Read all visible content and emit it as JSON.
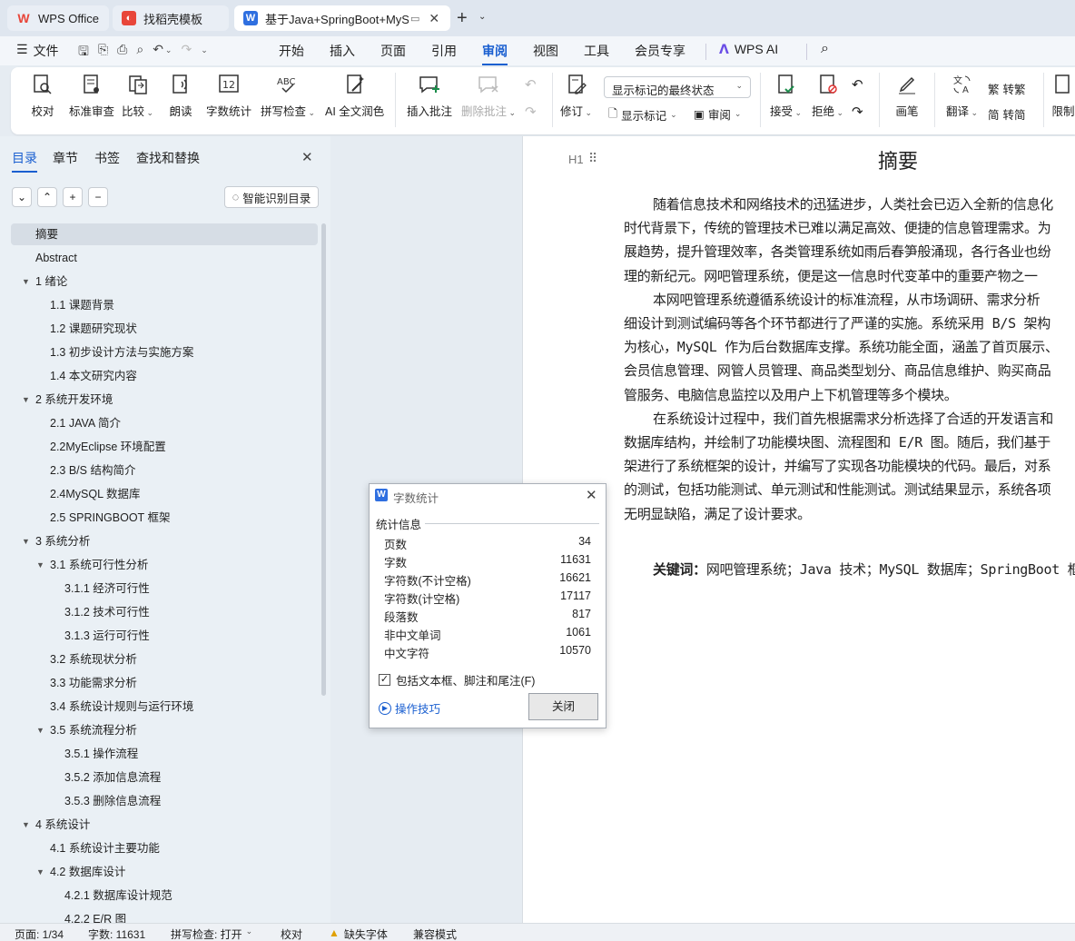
{
  "tabs": [
    {
      "label": "WPS Office",
      "icon": "wps-logo-icon"
    },
    {
      "label": "找稻壳模板",
      "icon": "docer-icon"
    },
    {
      "label": "基于Java+SpringBoot+MyS",
      "icon": "writer-doc-icon"
    }
  ],
  "menu": {
    "file": "文件",
    "items": [
      "开始",
      "插入",
      "页面",
      "引用",
      "审阅",
      "视图",
      "工具",
      "会员专享"
    ],
    "active": "审阅",
    "ai": "WPS AI"
  },
  "ribbon": {
    "proofread": "校对",
    "std_review": "标准审查",
    "compare": "比较",
    "read_aloud": "朗读",
    "word_count": "字数统计",
    "spell_check": "拼写检查",
    "ai_polish": "AI 全文润色",
    "insert_comment": "插入批注",
    "delete_comment": "删除批注",
    "markup_select": "显示标记的最终状态",
    "track": "修订",
    "show_markup": "显示标记",
    "review": "审阅",
    "accept": "接受",
    "reject": "拒绝",
    "ink": "画笔",
    "translate": "翻译",
    "to_traditional": "转繁",
    "to_simplified": "转简",
    "restrict": "限制"
  },
  "nav": {
    "tabs": [
      "目录",
      "章节",
      "书签",
      "查找和替换"
    ],
    "smart_toc": "智能识别目录",
    "items": [
      {
        "label": "摘要",
        "level": 1,
        "expand": false,
        "selected": true
      },
      {
        "label": "Abstract",
        "level": 1,
        "expand": false
      },
      {
        "label": "1  绪论",
        "level": 1,
        "expand": true
      },
      {
        "label": "1.1  课题背景",
        "level": 2,
        "expand": false
      },
      {
        "label": "1.2  课题研究现状",
        "level": 2,
        "expand": false
      },
      {
        "label": "1.3  初步设计方法与实施方案",
        "level": 2,
        "expand": false
      },
      {
        "label": "1.4  本文研究内容",
        "level": 2,
        "expand": false
      },
      {
        "label": "2  系统开发环境",
        "level": 1,
        "expand": true
      },
      {
        "label": "2.1 JAVA 简介",
        "level": 2,
        "expand": false
      },
      {
        "label": "2.2MyEclipse 环境配置",
        "level": 2,
        "expand": false
      },
      {
        "label": "2.3 B/S 结构简介",
        "level": 2,
        "expand": false
      },
      {
        "label": "2.4MySQL 数据库",
        "level": 2,
        "expand": false
      },
      {
        "label": "2.5 SPRINGBOOT 框架",
        "level": 2,
        "expand": false
      },
      {
        "label": "3  系统分析",
        "level": 1,
        "expand": true
      },
      {
        "label": "3.1  系统可行性分析",
        "level": 2,
        "expand": true
      },
      {
        "label": "3.1.1  经济可行性",
        "level": 3,
        "expand": false
      },
      {
        "label": "3.1.2  技术可行性",
        "level": 3,
        "expand": false
      },
      {
        "label": "3.1.3  运行可行性",
        "level": 3,
        "expand": false
      },
      {
        "label": "3.2  系统现状分析",
        "level": 2,
        "expand": false
      },
      {
        "label": "3.3  功能需求分析",
        "level": 2,
        "expand": false
      },
      {
        "label": "3.4  系统设计规则与运行环境",
        "level": 2,
        "expand": false
      },
      {
        "label": "3.5 系统流程分析",
        "level": 2,
        "expand": true
      },
      {
        "label": "3.5.1 操作流程",
        "level": 3,
        "expand": false
      },
      {
        "label": "3.5.2 添加信息流程",
        "level": 3,
        "expand": false
      },
      {
        "label": "3.5.3 删除信息流程",
        "level": 3,
        "expand": false
      },
      {
        "label": "4  系统设计",
        "level": 1,
        "expand": true
      },
      {
        "label": "4.1  系统设计主要功能",
        "level": 2,
        "expand": false
      },
      {
        "label": "4.2  数据库设计",
        "level": 2,
        "expand": true
      },
      {
        "label": "4.2.1  数据库设计规范",
        "level": 3,
        "expand": false
      },
      {
        "label": "4.2.2 E/R 图",
        "level": 3,
        "expand": false
      }
    ]
  },
  "doc": {
    "heading_marker": "H1",
    "title": "摘要",
    "lines": [
      "随着信息技术和网络技术的迅猛进步，人类社会已迈入全新的信息化",
      "时代背景下，传统的管理技术已难以满足高效、便捷的信息管理需求。为",
      "展趋势，提升管理效率，各类管理系统如雨后春笋般涌现，各行各业也纷",
      "理的新纪元。网吧管理系统，便是这一信息时代变革中的重要产物之一",
      "本网吧管理系统遵循系统设计的标准流程，从市场调研、需求分析",
      "细设计到测试编码等各个环节都进行了严谨的实施。系统采用 B/S 架构",
      "为核心，MySQL 作为后台数据库支撑。系统功能全面，涵盖了首页展示、",
      "会员信息管理、网管人员管理、商品类型划分、商品信息维护、购买商品",
      "管服务、电脑信息监控以及用户上下机管理等多个模块。",
      "在系统设计过程中，我们首先根据需求分析选择了合适的开发语言和",
      "数据库结构，并绘制了功能模块图、流程图和 E/R 图。随后，我们基于",
      "架进行了系统框架的设计，并编写了实现各功能模块的代码。最后，对系",
      "的测试，包括功能测试、单元测试和性能测试。测试结果显示，系统各项",
      "无明显缺陷，满足了设计要求。"
    ],
    "keywords_label": "关键词：",
    "keywords": "网吧管理系统；Java 技术；MySQL 数据库；SpringBoot 框"
  },
  "dialog": {
    "title": "字数统计",
    "section": "统计信息",
    "stats": [
      {
        "label": "页数",
        "value": "34"
      },
      {
        "label": "字数",
        "value": "11631"
      },
      {
        "label": "字符数(不计空格)",
        "value": "16621"
      },
      {
        "label": "字符数(计空格)",
        "value": "17117"
      },
      {
        "label": "段落数",
        "value": "817"
      },
      {
        "label": "非中文单词",
        "value": "1061"
      },
      {
        "label": "中文字符",
        "value": "10570"
      }
    ],
    "checkbox_label": "包括文本框、脚注和尾注(F)",
    "checkbox_checked": true,
    "tips": "操作技巧",
    "close": "关闭"
  },
  "status": {
    "page": "页面: 1/34",
    "words": "字数: 11631",
    "spell": "拼写检查: 打开",
    "proof": "校对",
    "missing_font": "缺失字体",
    "compat": "兼容模式"
  },
  "colors": {
    "accent": "#1a5fd0",
    "wps_red": "#e8463a",
    "writer_blue": "#2f6fe0"
  }
}
